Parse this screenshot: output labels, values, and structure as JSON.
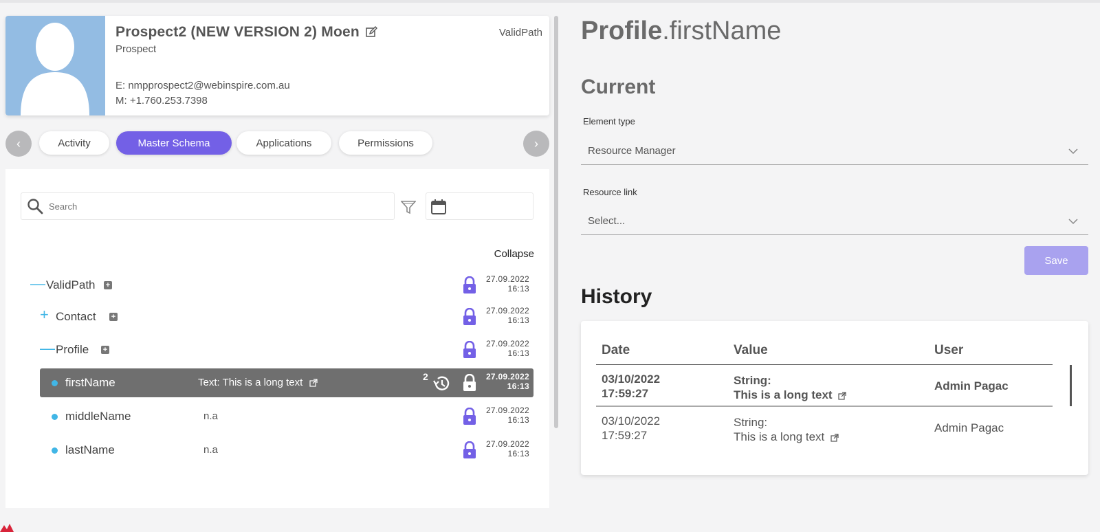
{
  "profile": {
    "name": "Prospect2 (NEW VERSION 2) Moen",
    "role": "Prospect",
    "brand": "ValidPath",
    "email": "E:  nmpprospect2@webinspire.com.au",
    "mobile": "M: +1.760.253.7398"
  },
  "tabs": [
    {
      "label": "Activity",
      "active": false
    },
    {
      "label": "Master Schema",
      "active": true
    },
    {
      "label": "Applications",
      "active": false
    },
    {
      "label": "Permissions",
      "active": false
    }
  ],
  "nav": {
    "prev": "‹",
    "next": "›"
  },
  "search": {
    "placeholder": "Search"
  },
  "collapse_label": "Collapse",
  "tree": [
    {
      "toggle": "—",
      "label": "ValidPath",
      "date": "27.09.2022",
      "time": "16:13"
    },
    {
      "toggle": "+",
      "label": "Contact",
      "date": "27.09.2022",
      "time": "16:13"
    },
    {
      "toggle": "—",
      "label": "Profile",
      "date": "27.09.2022",
      "time": "16:13"
    },
    {
      "label": "firstName",
      "value": "Text:  This is a long text",
      "history_count": "2",
      "date": "27.09.2022",
      "time": "16:13",
      "selected": true
    },
    {
      "label": "middleName",
      "value": "n.a",
      "date": "27.09.2022",
      "time": "16:13"
    },
    {
      "label": "lastName",
      "value": "n.a",
      "date": "27.09.2022",
      "time": "16:13"
    }
  ],
  "detail": {
    "title_bold": "Profile",
    "title_rest": ".firstName",
    "current_heading": "Current",
    "element_type_label": "Element type",
    "element_type_value": "Resource Manager",
    "resource_link_label": "Resource link",
    "resource_link_placeholder": "Select...",
    "save_label": "Save",
    "history_heading": "History"
  },
  "history": {
    "columns": [
      "Date",
      "Value",
      "User"
    ],
    "rows": [
      {
        "date": "03/10/2022",
        "time": "17:59:27",
        "type": "String:",
        "value": "This is a long text",
        "user": "Admin Pagac",
        "bold": true
      },
      {
        "date": "03/10/2022",
        "time": "17:59:27",
        "type": "String:",
        "value": "This is a long text",
        "user": "Admin Pagac",
        "bold": false
      }
    ]
  },
  "colors": {
    "accent": "#7360e6",
    "tree_toggle": "#41b6e6",
    "selected_row": "#6f6f6f",
    "avatar_bg": "#93bce3"
  }
}
